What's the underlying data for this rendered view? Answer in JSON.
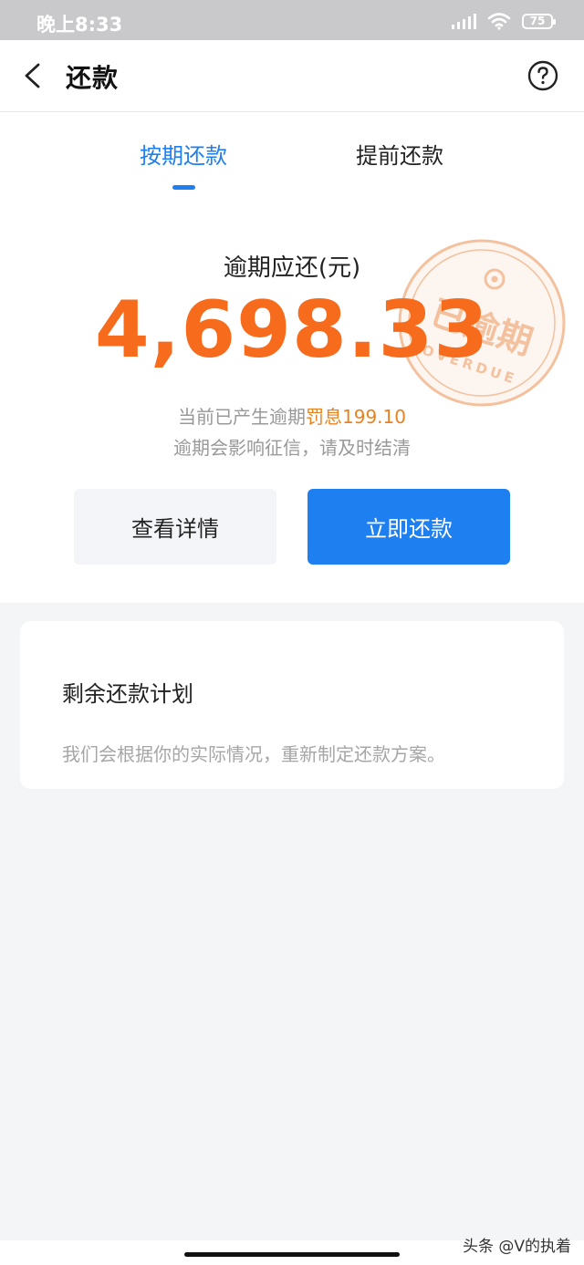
{
  "status_bar": {
    "time": "晚上8:33",
    "battery": "75"
  },
  "nav": {
    "title": "还款"
  },
  "tabs": [
    {
      "label": "按期还款",
      "active": true
    },
    {
      "label": "提前还款",
      "active": false
    }
  ],
  "summary": {
    "label": "逾期应还(元)",
    "amount": "4,698.33",
    "penalty_prefix": "当前已产生逾期",
    "penalty_label": "罚息",
    "penalty_value": "199.10",
    "warning": "逾期会影响征信，请及时结清"
  },
  "stamp": {
    "main": "已逾期",
    "sub": "OVERDUE"
  },
  "actions": {
    "details_label": "查看详情",
    "pay_label": "立即还款"
  },
  "plan": {
    "title": "剩余还款计划",
    "description": "我们会根据你的实际情况，重新制定还款方案。"
  },
  "watermark": "头条 @V的执着",
  "colors": {
    "accent": "#1e7ff0",
    "amount": "#f76b1c",
    "penalty": "#e8821f",
    "stamp": "#f1ad7e"
  }
}
